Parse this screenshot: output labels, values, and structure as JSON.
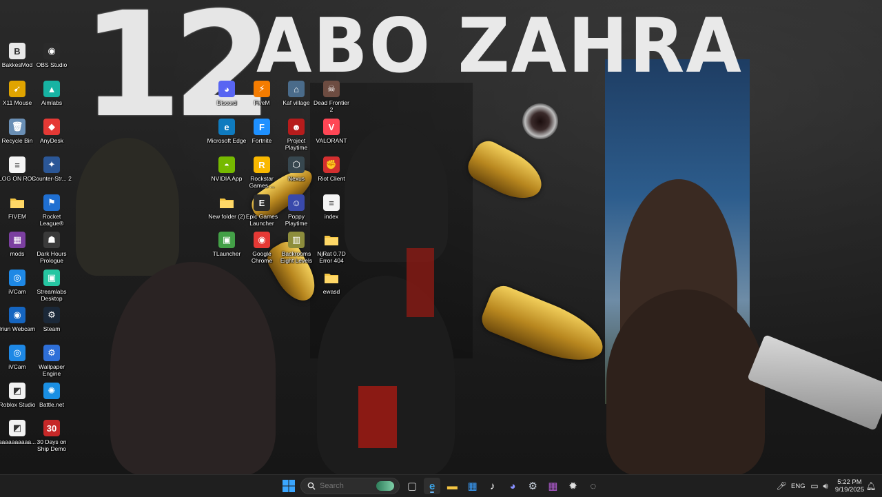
{
  "wallpaper": {
    "number_text": "12",
    "title_text": "ABO ZAHRA"
  },
  "desktop_icons": [
    {
      "label": "BakkesMod",
      "icon": "bakkesmod-icon",
      "bg": "#e9e9e9",
      "glyph": "B"
    },
    {
      "label": "OBS Studio",
      "icon": "obs-icon",
      "bg": "#2a2a2a",
      "glyph": "◉"
    },
    {
      "label": "X11 Mouse",
      "icon": "mouse-cursor-icon",
      "bg": "#e0a400",
      "glyph": "➹"
    },
    {
      "label": "Aimlabs",
      "icon": "aimlabs-icon",
      "bg": "#17b3a3",
      "glyph": "▲"
    },
    {
      "label": "Recycle Bin",
      "icon": "recycle-bin-icon",
      "bg": "#6a8fb5",
      "glyph": "🗑"
    },
    {
      "label": "AnyDesk",
      "icon": "anydesk-icon",
      "bg": "#e53935",
      "glyph": "◆"
    },
    {
      "label": "LOG ON ROK",
      "icon": "document-icon",
      "bg": "#f5f5f5",
      "glyph": "≡"
    },
    {
      "label": "Counter-Str... 2",
      "icon": "counter-strike-icon",
      "bg": "#2b5797",
      "glyph": "✦"
    },
    {
      "label": "FIVEM",
      "icon": "folder-icon",
      "bg": "#f4c542",
      "glyph": ""
    },
    {
      "label": "Rocket League®",
      "icon": "rocket-league-icon",
      "bg": "#1f6fd1",
      "glyph": "⚑"
    },
    {
      "label": "mods",
      "icon": "winrar-icon",
      "bg": "#7b3fa0",
      "glyph": "▦"
    },
    {
      "label": "Dark Hours Prologue",
      "icon": "dark-hours-icon",
      "bg": "#3a3a3a",
      "glyph": "☗"
    },
    {
      "label": "iVCam",
      "icon": "ivcam-icon",
      "bg": "#1e88e5",
      "glyph": "◎"
    },
    {
      "label": "Streamlabs Desktop",
      "icon": "streamlabs-icon",
      "bg": "#26c6a2",
      "glyph": "▣"
    },
    {
      "label": "Iriun Webcam",
      "icon": "iriun-webcam-icon",
      "bg": "#1565c0",
      "glyph": "◉"
    },
    {
      "label": "Steam",
      "icon": "steam-icon",
      "bg": "#1b2838",
      "glyph": "⚙"
    },
    {
      "label": "iVCam",
      "icon": "ivcam-icon",
      "bg": "#1e88e5",
      "glyph": "◎"
    },
    {
      "label": "Wallpaper Engine",
      "icon": "wallpaper-engine-icon",
      "bg": "#2e6fd8",
      "glyph": "⚙"
    },
    {
      "label": "Roblox Studio",
      "icon": "roblox-studio-icon",
      "bg": "#f2f2f2",
      "glyph": "◩"
    },
    {
      "label": "Battle.net",
      "icon": "battlenet-icon",
      "bg": "#1a8fe3",
      "glyph": "✺"
    },
    {
      "label": "aaaaaaaaaa...",
      "icon": "roblox-icon",
      "bg": "#f2f2f2",
      "glyph": "◩"
    },
    {
      "label": "30 Days on Ship Demo",
      "icon": "30-days-on-ship-icon",
      "bg": "#c62828",
      "glyph": "30"
    },
    {
      "label": "Discord",
      "icon": "discord-icon",
      "bg": "#5865f2",
      "glyph": "◕"
    },
    {
      "label": "FiveM",
      "icon": "fivem-icon",
      "bg": "#f57c00",
      "glyph": "⚡"
    },
    {
      "label": "Kaf village",
      "icon": "kaf-village-icon",
      "bg": "#4a6b8a",
      "glyph": "⌂"
    },
    {
      "label": "Dead Frontier 2",
      "icon": "dead-frontier-icon",
      "bg": "#6d4c41",
      "glyph": "☠"
    },
    {
      "label": "Microsoft Edge",
      "icon": "edge-icon",
      "bg": "#0f7bbf",
      "glyph": "e"
    },
    {
      "label": "Fortnite",
      "icon": "fortnite-icon",
      "bg": "#1e90ff",
      "glyph": "F"
    },
    {
      "label": "Project Playtime",
      "icon": "project-playtime-icon",
      "bg": "#b71c1c",
      "glyph": "☻"
    },
    {
      "label": "VALORANT",
      "icon": "valorant-icon",
      "bg": "#ff4655",
      "glyph": "V"
    },
    {
      "label": "NVIDIA App",
      "icon": "nvidia-icon",
      "bg": "#76b900",
      "glyph": "◓"
    },
    {
      "label": "Rockstar Games ...",
      "icon": "rockstar-icon",
      "bg": "#f9b800",
      "glyph": "R"
    },
    {
      "label": "Nexus",
      "icon": "nexus-icon",
      "bg": "#37474f",
      "glyph": "⬡"
    },
    {
      "label": "Riot Client",
      "icon": "riot-client-icon",
      "bg": "#d32f2f",
      "glyph": "✊"
    },
    {
      "label": "New folder (2)",
      "icon": "folder-icon",
      "bg": "#f4c542",
      "glyph": ""
    },
    {
      "label": "Epic Games Launcher",
      "icon": "epic-games-icon",
      "bg": "#2a2a2a",
      "glyph": "E"
    },
    {
      "label": "Poppy Playtime",
      "icon": "poppy-playtime-icon",
      "bg": "#3949ab",
      "glyph": "☺"
    },
    {
      "label": "index",
      "icon": "document-icon",
      "bg": "#f5f5f5",
      "glyph": "≡"
    },
    {
      "label": "TLauncher",
      "icon": "tlauncher-icon",
      "bg": "#43a047",
      "glyph": "▣"
    },
    {
      "label": "Google Chrome",
      "icon": "chrome-icon",
      "bg": "#e53935",
      "glyph": "◉"
    },
    {
      "label": "Backrooms Eight Levels",
      "icon": "backrooms-icon",
      "bg": "#8d8d3c",
      "glyph": "▥"
    },
    {
      "label": "NjRat 0.7D Error 404",
      "icon": "folder-icon",
      "bg": "#f4c542",
      "glyph": ""
    },
    {
      "label": "ewasd",
      "icon": "folder-icon",
      "bg": "#f4c542",
      "glyph": ""
    }
  ],
  "taskbar": {
    "search_placeholder": "Search",
    "apps": [
      {
        "name": "task-view-icon",
        "glyph": "▢",
        "color": "#cfcfcf"
      },
      {
        "name": "edge-taskbar-icon",
        "glyph": "e",
        "color": "#3ca7ea"
      },
      {
        "name": "file-explorer-icon",
        "glyph": "▬",
        "color": "#f4c542"
      },
      {
        "name": "microsoft-store-icon",
        "glyph": "▦",
        "color": "#3aa0ff"
      },
      {
        "name": "tiktok-icon",
        "glyph": "♪",
        "color": "#ffffff"
      },
      {
        "name": "discord-taskbar-icon",
        "glyph": "◕",
        "color": "#8891ff"
      },
      {
        "name": "steam-taskbar-icon",
        "glyph": "⚙",
        "color": "#cfd8e3"
      },
      {
        "name": "winrar-taskbar-icon",
        "glyph": "▦",
        "color": "#b05bd0"
      },
      {
        "name": "steelseries-icon",
        "glyph": "✹",
        "color": "#e0e0e0"
      },
      {
        "name": "settings-app-icon",
        "glyph": "◌",
        "color": "#d0d0d0"
      }
    ],
    "language": "ENG",
    "time": "5:22 PM",
    "date": "9/19/2025"
  }
}
